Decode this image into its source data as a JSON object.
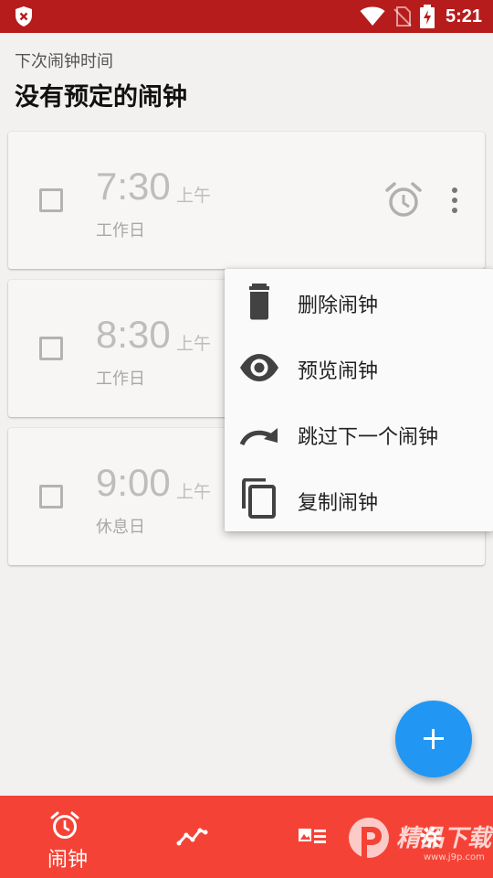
{
  "status_bar": {
    "time": "5:21"
  },
  "header": {
    "subtitle": "下次闹钟时间",
    "title": "没有预定的闹钟"
  },
  "alarms": [
    {
      "time": "7:30",
      "ampm": "上午",
      "days": "工作日",
      "enabled": false
    },
    {
      "time": "8:30",
      "ampm": "上午",
      "days": "工作日",
      "enabled": false
    },
    {
      "time": "9:00",
      "ampm": "上午",
      "days": "休息日",
      "enabled": false
    }
  ],
  "menu": {
    "items": [
      {
        "label": "删除闹钟",
        "icon": "delete-icon"
      },
      {
        "label": "预览闹钟",
        "icon": "eye-icon"
      },
      {
        "label": "跳过下一个闹钟",
        "icon": "skip-icon"
      },
      {
        "label": "复制闹钟",
        "icon": "copy-icon"
      }
    ]
  },
  "bottom_nav": {
    "items": [
      {
        "label": "闹钟",
        "icon": "alarm-clock-icon",
        "active": true
      },
      {
        "label": "",
        "icon": "stats-icon",
        "active": false
      },
      {
        "label": "",
        "icon": "card-icon",
        "active": false
      },
      {
        "label": "",
        "icon": "settings-icon",
        "active": false
      }
    ]
  },
  "watermark": {
    "text": "精品下载",
    "url": "www.j9p.com"
  },
  "colors": {
    "status_bar": "#b71c1c",
    "bottom_nav": "#f44336",
    "fab": "#2196f3",
    "background": "#f2f1f0"
  }
}
